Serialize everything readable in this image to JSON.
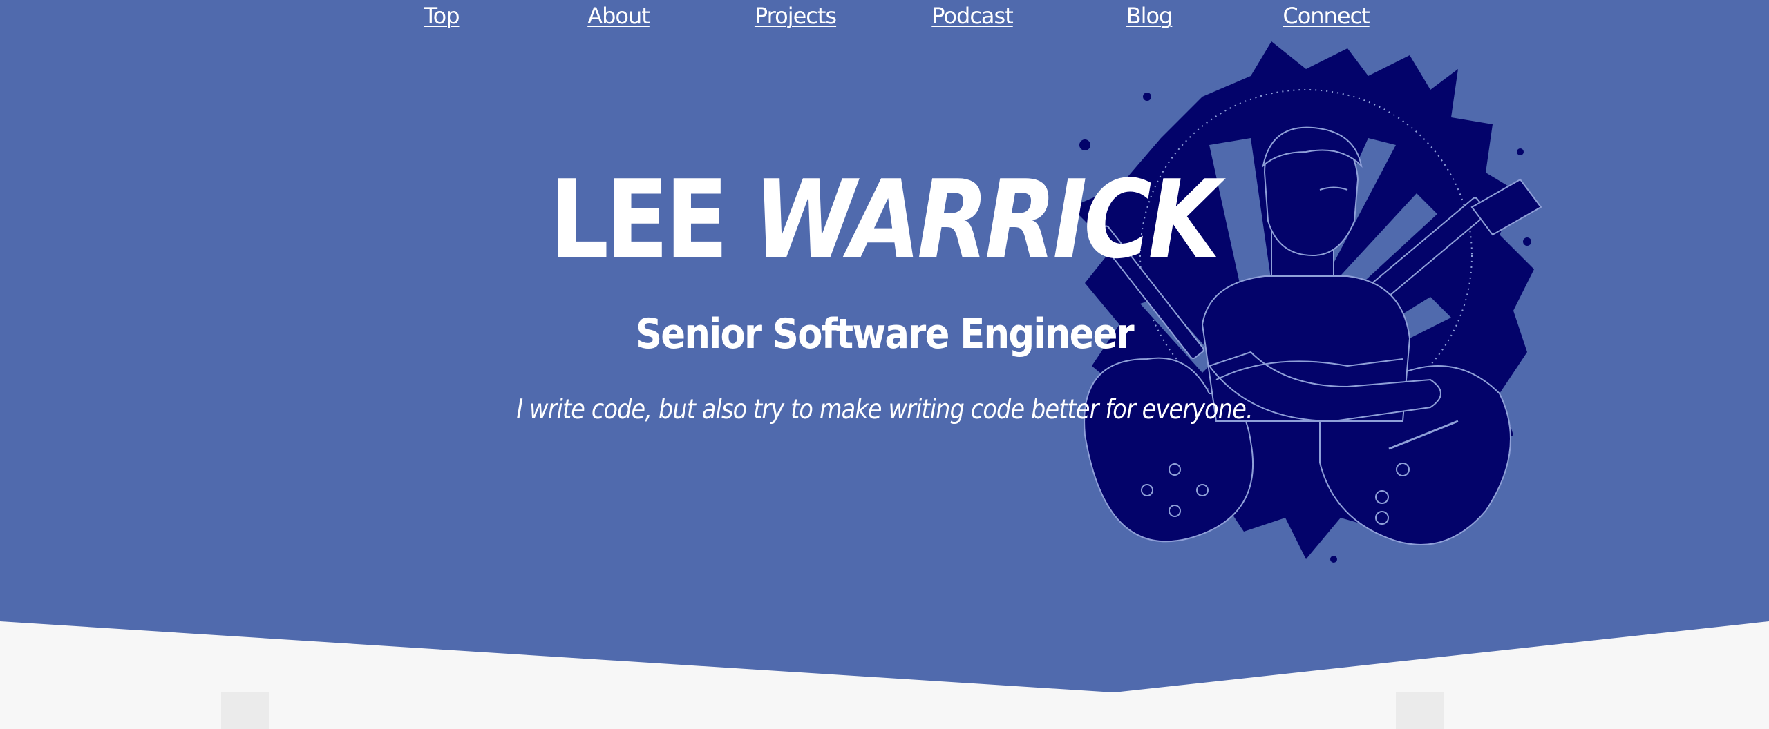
{
  "nav": {
    "items": [
      {
        "label": "Top"
      },
      {
        "label": "About"
      },
      {
        "label": "Projects"
      },
      {
        "label": "Podcast"
      },
      {
        "label": "Blog"
      },
      {
        "label": "Connect"
      }
    ]
  },
  "hero": {
    "first_name": "LEE",
    "last_name": "WARRICK",
    "role": "Senior Software Engineer",
    "tagline": "I write code, but also try to make writing code better for everyone."
  },
  "colors": {
    "hero_background": "#506aad",
    "illustration_ink": "#03036a",
    "text": "#ffffff",
    "page_background": "#f7f7f7"
  }
}
